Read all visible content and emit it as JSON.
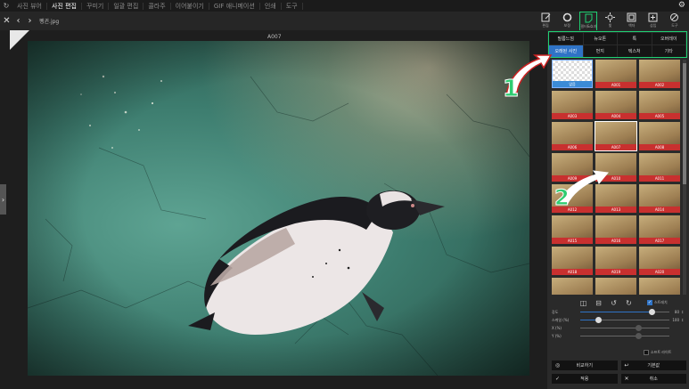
{
  "topbar": {
    "menus": [
      {
        "label": "사진 뷰어",
        "active": false
      },
      {
        "label": "사진 편집",
        "active": true
      },
      {
        "label": "꾸미기",
        "active": false
      },
      {
        "label": "일괄 편집",
        "active": false
      },
      {
        "label": "콜라주",
        "active": false
      },
      {
        "label": "이어붙이기",
        "active": false
      },
      {
        "label": "GIF 애니메이션",
        "active": false
      },
      {
        "label": "인쇄",
        "active": false
      },
      {
        "label": "도구",
        "active": false
      }
    ]
  },
  "nav": {
    "filename": "펭귄.jpg"
  },
  "toolbar": {
    "tools": [
      {
        "label": "편집",
        "icon": "edit-icon",
        "active": false
      },
      {
        "label": "보정",
        "icon": "circle-icon",
        "active": false
      },
      {
        "label": "필터&효과",
        "icon": "filter-icon",
        "active": true
      },
      {
        "label": "빛",
        "icon": "sun-icon",
        "active": false
      },
      {
        "label": "액자",
        "icon": "frame-icon",
        "active": false
      },
      {
        "label": "삽입",
        "icon": "insert-icon",
        "active": false
      },
      {
        "label": "도구",
        "icon": "tools-icon",
        "active": false
      }
    ]
  },
  "canvas": {
    "image_title": "A007"
  },
  "panel": {
    "tabs_row1": [
      {
        "label": "필름느낌",
        "active": false
      },
      {
        "label": "뉴오톤",
        "active": false
      },
      {
        "label": "톡",
        "active": false
      },
      {
        "label": "오버레이",
        "active": false
      }
    ],
    "tabs_row2": [
      {
        "label": "오래된 사진",
        "active": true
      },
      {
        "label": "먼지",
        "active": false
      },
      {
        "label": "텍스처",
        "active": false
      },
      {
        "label": "기타",
        "active": false
      }
    ],
    "thumbs": [
      {
        "label": "없음",
        "type": "none"
      },
      {
        "label": "A001"
      },
      {
        "label": "A002"
      },
      {
        "label": "A003"
      },
      {
        "label": "A004"
      },
      {
        "label": "A005"
      },
      {
        "label": "A006"
      },
      {
        "label": "A007",
        "selected": true
      },
      {
        "label": "A008"
      },
      {
        "label": "A009"
      },
      {
        "label": "A010"
      },
      {
        "label": "A011"
      },
      {
        "label": "A012"
      },
      {
        "label": "A013"
      },
      {
        "label": "A014"
      },
      {
        "label": "A015"
      },
      {
        "label": "A016"
      },
      {
        "label": "A017"
      },
      {
        "label": "A018"
      },
      {
        "label": "A019"
      },
      {
        "label": "A020"
      },
      {
        "label": "A021"
      },
      {
        "label": "A022"
      },
      {
        "label": "A023"
      }
    ],
    "stretch_label": "스트레치",
    "sliders": [
      {
        "label": "강도",
        "value": "80",
        "level": 0.8,
        "enabled": true
      },
      {
        "label": "스케일 (%)",
        "value": "100",
        "level": 0.2,
        "enabled": true
      },
      {
        "label": "X (%)",
        "value": "",
        "level": 0.65,
        "enabled": false
      },
      {
        "label": "Y (%)",
        "value": "",
        "level": 0.65,
        "enabled": false
      }
    ],
    "soft_light_label": "소프트 라이트",
    "buttons": {
      "compare": "비교하기",
      "reset": "기본값",
      "apply": "적용",
      "cancel": "취소"
    }
  },
  "annotations": {
    "one": "1",
    "two": "2"
  },
  "colors": {
    "accent_green": "#1fd173",
    "selected_blue": "#2f73c6",
    "thumb_caption_red": "#c8302f"
  }
}
